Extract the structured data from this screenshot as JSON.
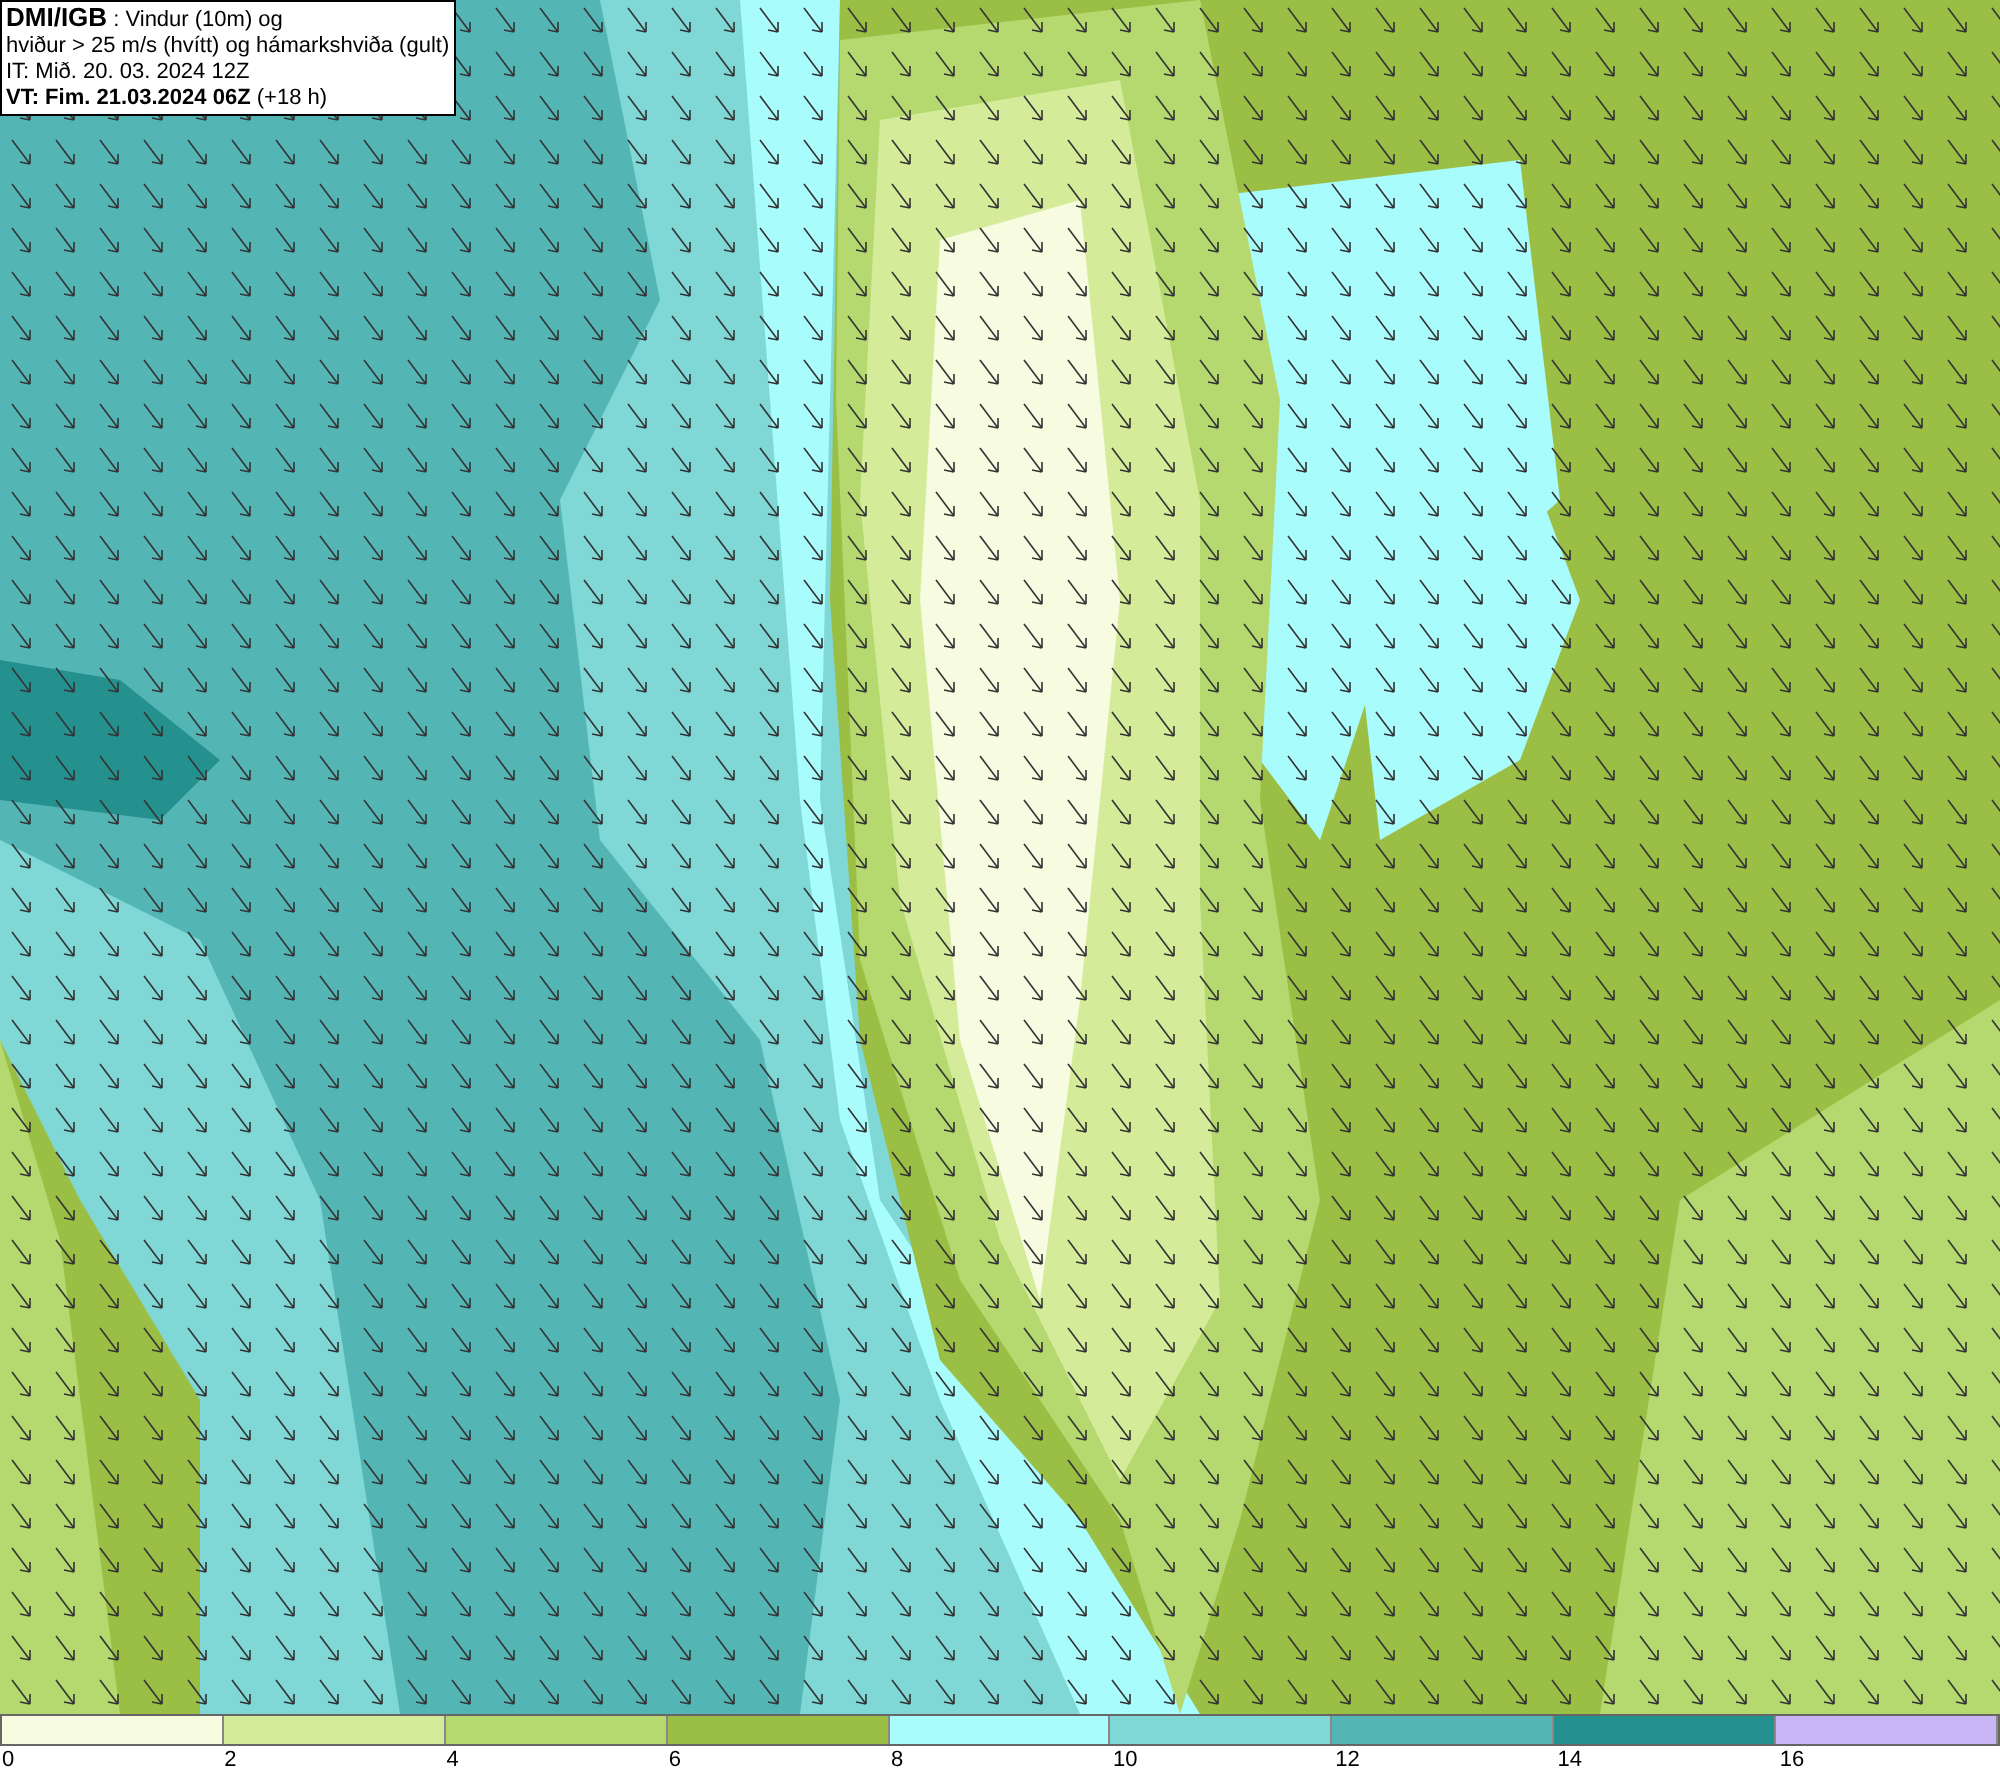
{
  "title_box": {
    "source": "DMI/IGB",
    "lines": [
      ": Vindur (10m) og",
      "hviður > 25 m/s (hvítt) og hámarkshviða (gult)",
      "IT: Mið. 20. 03. 2024 12Z"
    ],
    "valid_time": "VT: Fim. 21.03.2024 06Z",
    "lead": "(+18 h)"
  },
  "legend": {
    "bins": [
      {
        "color": "#f7fbe0"
      },
      {
        "color": "#d4ec9a"
      },
      {
        "color": "#b5d96e"
      },
      {
        "color": "#9bbe45"
      },
      {
        "color": "#a8fcfc"
      },
      {
        "color": "#7fd8d6"
      },
      {
        "color": "#54b5b5"
      },
      {
        "color": "#25918f"
      },
      {
        "color": "#c7b5f6"
      }
    ],
    "ticks": [
      "0",
      "2",
      "4",
      "6",
      "8",
      "10",
      "12",
      "14",
      "16"
    ]
  }
}
